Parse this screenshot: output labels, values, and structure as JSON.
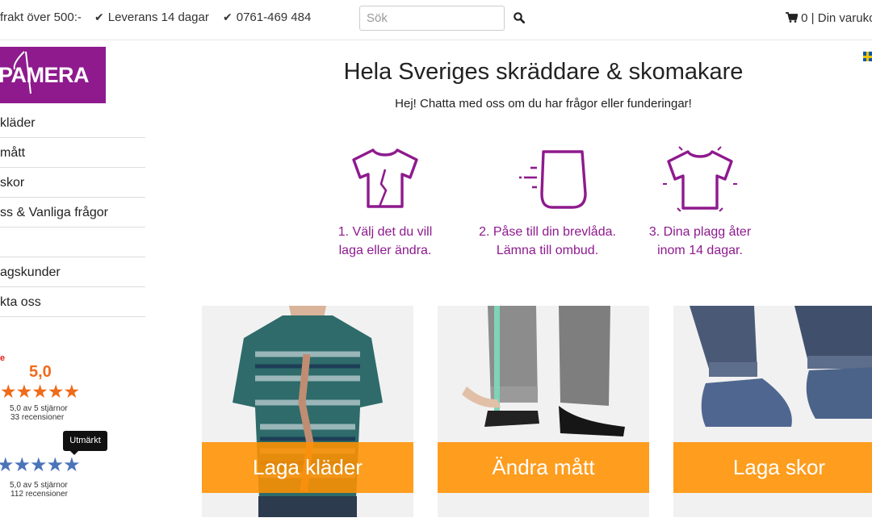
{
  "topbar": {
    "usp_1": "frakt över 500:-",
    "usp_2": "Leverans 14 dagar",
    "usp_3": "0761-469 484",
    "search_placeholder": "Sök",
    "cart_label": "0 | Din varuko"
  },
  "logo": {
    "text": "PAMERA"
  },
  "sidebar": {
    "items": [
      {
        "label": "kläder"
      },
      {
        "label": " mått"
      },
      {
        "label": "skor"
      },
      {
        "label": "ss & Vanliga frågor"
      },
      {
        "label": ""
      },
      {
        "label": "agskunder"
      },
      {
        "label": "kta oss"
      }
    ]
  },
  "reviews": {
    "mark": "e",
    "score": "5,0",
    "stars_1": "★★★★★",
    "line_1a": "5,0 av 5 stjärnor",
    "line_1b": "33 recensioner",
    "tooltip": "Utmärkt",
    "stars_2": "★★★★★",
    "line_2a": "5,0 av 5 stjärnor",
    "line_2b": "112 recensioner"
  },
  "main": {
    "title": "Hela Sveriges skräddare & skomakare",
    "subtitle": "Hej! Chatta med oss om du har frågor eller funderingar!",
    "steps": [
      {
        "line1": "1. Välj det du vill",
        "line2": "laga eller ändra.",
        "icon": "torn-shirt-icon"
      },
      {
        "line1": "2. Påse till din brevlåda.",
        "line2": "Lämna till ombud.",
        "icon": "moving-bag-icon"
      },
      {
        "line1": "3. Dina plagg åter",
        "line2": "inom 14 dagar.",
        "icon": "fixed-shirt-icon"
      }
    ],
    "cards": [
      {
        "label": "Laga kläder"
      },
      {
        "label": "Ändra mått"
      },
      {
        "label": "Laga skor"
      }
    ]
  },
  "colors": {
    "brand": "#8e1a8e",
    "accent_orange": "#ff9100",
    "review_orange": "#f06a1a",
    "review_blue": "#4b74b8"
  }
}
